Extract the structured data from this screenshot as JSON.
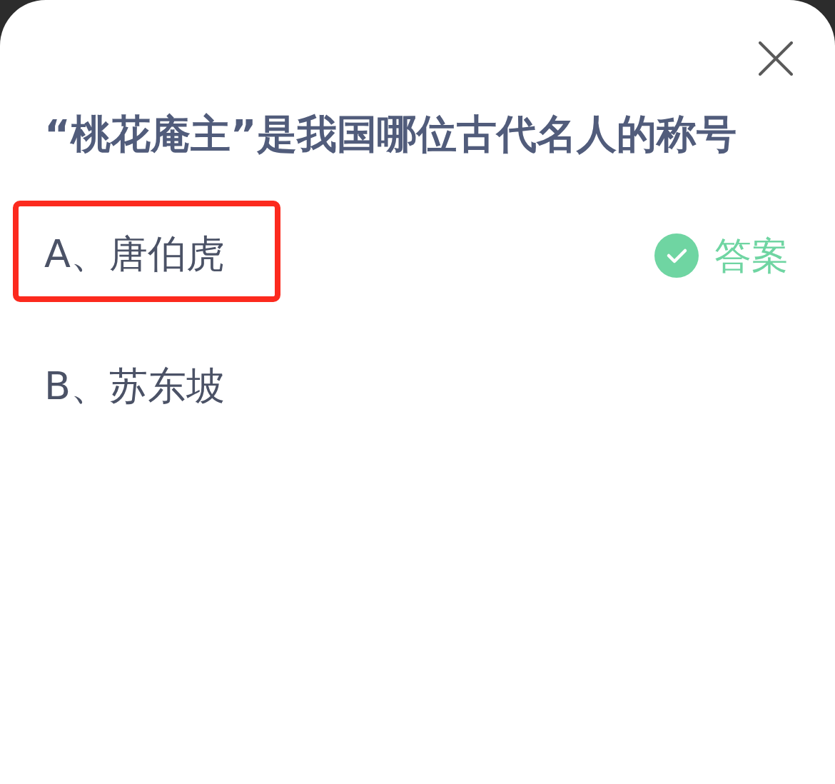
{
  "question": {
    "title": "“桃花庵主”是我国哪位古代名人的称号"
  },
  "answer_label": "答案",
  "options": [
    {
      "label": "A、唐伯虎",
      "correct": true,
      "marked": true
    },
    {
      "label": "B、苏东坡",
      "correct": false,
      "marked": false
    }
  ]
}
